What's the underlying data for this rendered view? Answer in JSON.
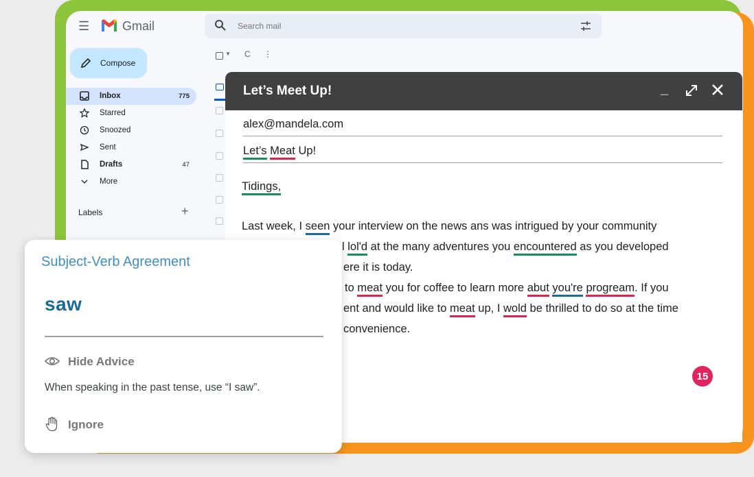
{
  "app": {
    "name": "Gmail",
    "search_placeholder": "Search mail"
  },
  "sidebar": {
    "compose_label": "Compose",
    "items": [
      {
        "label": "Inbox",
        "count": "775",
        "icon": "inbox-icon"
      },
      {
        "label": "Starred",
        "count": "",
        "icon": "star-icon"
      },
      {
        "label": "Snoozed",
        "count": "",
        "icon": "clock-icon"
      },
      {
        "label": "Sent",
        "count": "",
        "icon": "send-icon"
      },
      {
        "label": "Drafts",
        "count": "47",
        "icon": "draft-icon"
      },
      {
        "label": "More",
        "count": "",
        "icon": "chevron-down-icon"
      }
    ],
    "labels_heading": "Labels",
    "labels_add": "+"
  },
  "toolbar": {
    "refresh_glyph": "C",
    "more_glyph": "⋮"
  },
  "compose_window": {
    "title": "Let’s Meet Up!",
    "minimize_glyph": "_",
    "to": "alex@mandela.com",
    "subject": {
      "part1": "Let’s",
      "part2": "Meat",
      "part3": "Up!"
    },
    "greeting": "Tidings,",
    "lines": {
      "l1": {
        "a": "Last week, I ",
        "seen": "seen",
        "b": " your interview on the news ans was intrigued by your community"
      },
      "l2": {
        "a": "l ",
        "lold": "lol'd",
        "b": " at the many adventures you ",
        "enc": "encountered",
        "c": " as you developed"
      },
      "l3": {
        "a": "ere it is today."
      },
      "l4": {
        "a": "to ",
        "meat": "meat",
        "b": " you for coffee to learn more ",
        "abut": "abut",
        "c": " ",
        "youre": "you're",
        "d": " ",
        "prog": "progream",
        "e": ". If you"
      },
      "l5": {
        "a": "ent and would like to ",
        "meat": "meat",
        "b": " up, I ",
        "wold": "wold",
        "c": " be thrilled to do so at the time"
      },
      "l6": {
        "a": "convenience."
      }
    },
    "issue_count": "15"
  },
  "advice_card": {
    "category": "Subject-Verb Agreement",
    "suggestion": "saw",
    "hide_label": "Hide Advice",
    "explanation": "When speaking in the past tense, use “I saw”.",
    "ignore_label": "Ignore"
  },
  "colors": {
    "green_frame": "#8cc43c",
    "orange_frame": "#f7941d",
    "underline_green": "#1d8a5e",
    "underline_red": "#d7264f",
    "underline_blue": "#1c6a98",
    "badge": "#e0245e"
  }
}
